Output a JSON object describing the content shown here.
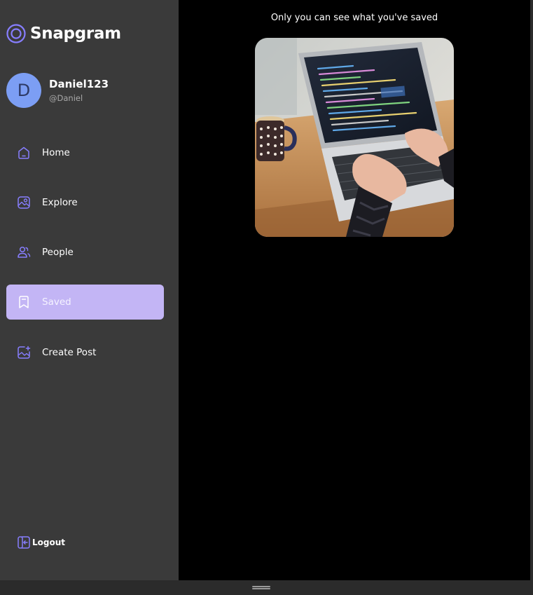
{
  "app": {
    "name": "Snapgram"
  },
  "profile": {
    "initial": "D",
    "name": "Daniel123",
    "handle": "@Daniel"
  },
  "nav": {
    "items": [
      {
        "label": "Home",
        "icon": "home-icon"
      },
      {
        "label": "Explore",
        "icon": "explore-icon"
      },
      {
        "label": "People",
        "icon": "people-icon"
      },
      {
        "label": "Saved",
        "icon": "bookmark-icon",
        "active": true
      },
      {
        "label": "Create Post",
        "icon": "create-post-icon"
      }
    ],
    "logout_label": "Logout"
  },
  "main": {
    "note": "Only you can see what you've saved",
    "saved_posts": [
      {
        "image": "laptop-coding-photo"
      }
    ]
  },
  "colors": {
    "sidebar": "#3a3a3a",
    "accent": "#877eff",
    "active_nav": "#c3b5f5",
    "avatar": "#7c9ef4",
    "background": "#000000"
  }
}
